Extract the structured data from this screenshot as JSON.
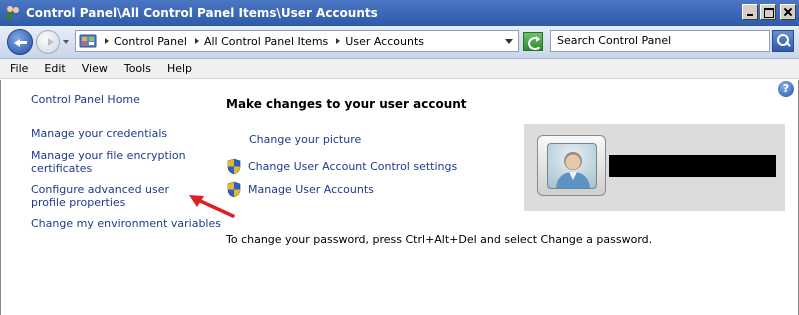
{
  "window": {
    "title": "Control Panel\\All Control Panel Items\\User Accounts"
  },
  "address_bar": {
    "breadcrumbs": [
      "Control Panel",
      "All Control Panel Items",
      "User Accounts"
    ],
    "search_placeholder": "Search Control Panel"
  },
  "menu": {
    "items": [
      "File",
      "Edit",
      "View",
      "Tools",
      "Help"
    ]
  },
  "sidebar": {
    "home_label": "Control Panel Home",
    "links": [
      "Manage your credentials",
      "Manage your file encryption certificates",
      "Configure advanced user profile properties",
      "Change my environment variables"
    ]
  },
  "main": {
    "heading": "Make changes to your user account",
    "tasks": [
      {
        "label": "Change your picture",
        "icon": "none"
      },
      {
        "label": "Change User Account Control settings",
        "icon": "uac-shield-icon"
      },
      {
        "label": "Manage User Accounts",
        "icon": "uac-shield-icon"
      }
    ],
    "password_hint": "To change your password, press Ctrl+Alt+Del and select Change a password."
  },
  "colors": {
    "link": "#1e3b8a",
    "titlebar": "#2e5aa8",
    "annotation_arrow": "#e02020"
  }
}
